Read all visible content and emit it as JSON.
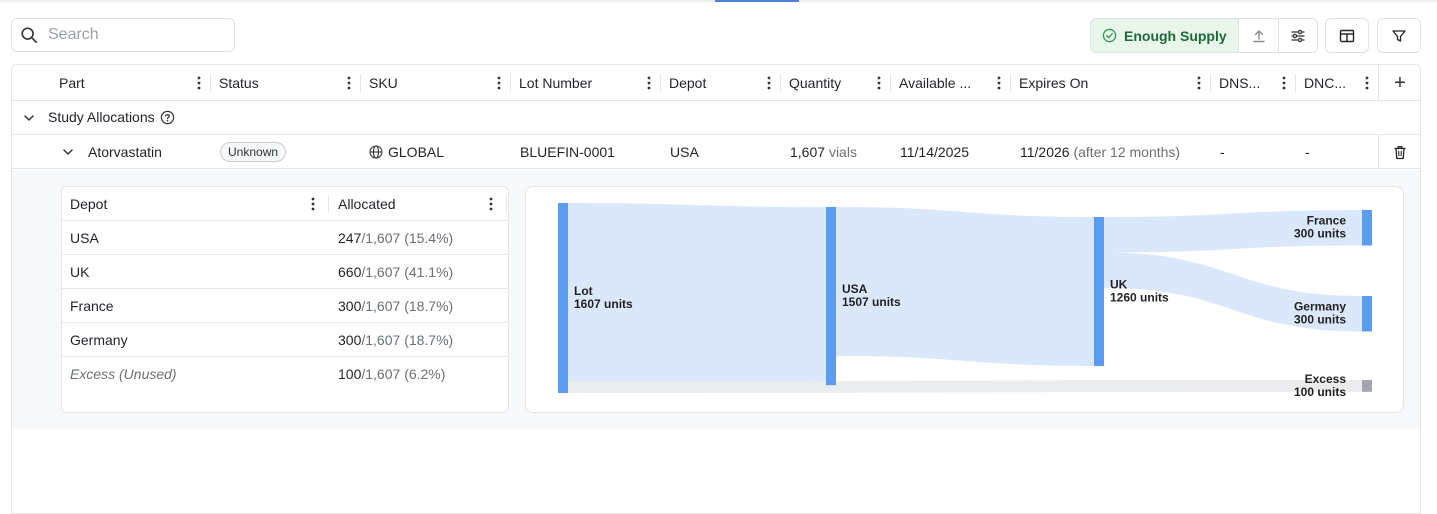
{
  "toolbar": {
    "search_placeholder": "Search",
    "supply_status": "Enough Supply",
    "supply_color": "#1e6b3a"
  },
  "columns": [
    {
      "label": "Part"
    },
    {
      "label": "Status"
    },
    {
      "label": "SKU"
    },
    {
      "label": "Lot Number"
    },
    {
      "label": "Depot"
    },
    {
      "label": "Quantity"
    },
    {
      "label": "Available ..."
    },
    {
      "label": "Expires On"
    },
    {
      "label": "DNS..."
    },
    {
      "label": "DNC..."
    }
  ],
  "group": {
    "title": "Study Allocations"
  },
  "row": {
    "part": "Atorvastatin",
    "status": "Unknown",
    "sku": "GLOBAL",
    "lot_number": "BLUEFIN-0001",
    "depot": "USA",
    "quantity": "1,607",
    "quantity_unit": "vials",
    "available": "11/14/2025",
    "expires": "11/2026",
    "expires_note": "(after 12 months)",
    "dns": "-",
    "dnc": "-"
  },
  "allocations": {
    "headers": {
      "depot": "Depot",
      "allocated": "Allocated"
    },
    "rows": [
      {
        "depot": "USA",
        "allocated": "247",
        "total": "/1,607",
        "pct": "(15.4%)",
        "italic": false
      },
      {
        "depot": "UK",
        "allocated": "660",
        "total": "/1,607",
        "pct": "(41.1%)",
        "italic": false
      },
      {
        "depot": "France",
        "allocated": "300",
        "total": "/1,607",
        "pct": "(18.7%)",
        "italic": false
      },
      {
        "depot": "Germany",
        "allocated": "300",
        "total": "/1,607",
        "pct": "(18.7%)",
        "italic": false
      },
      {
        "depot": "Excess (Unused)",
        "allocated": "100",
        "total": "/1,607",
        "pct": "(6.2%)",
        "italic": true
      }
    ]
  },
  "sankey": {
    "node_color": "#5b9cf0",
    "link_color": "#dbe8fb",
    "excess_color": "#a3a7ad",
    "excess_link_color": "#ebecee",
    "nodes": [
      {
        "id": "lot",
        "name": "Lot",
        "value": 1607,
        "label": "1607 units"
      },
      {
        "id": "usa",
        "name": "USA",
        "value": 1507,
        "label": "1507 units"
      },
      {
        "id": "uk",
        "name": "UK",
        "value": 1260,
        "label": "1260 units"
      },
      {
        "id": "france",
        "name": "France",
        "value": 300,
        "label": "300 units"
      },
      {
        "id": "germany",
        "name": "Germany",
        "value": 300,
        "label": "300 units"
      },
      {
        "id": "excess",
        "name": "Excess",
        "value": 100,
        "label": "100 units"
      }
    ],
    "links": [
      {
        "source": "lot",
        "target": "usa",
        "value": 1507
      },
      {
        "source": "lot",
        "target": "excess",
        "value": 100
      },
      {
        "source": "usa",
        "target": "uk",
        "value": 1260
      },
      {
        "source": "uk",
        "target": "france",
        "value": 300
      },
      {
        "source": "uk",
        "target": "germany",
        "value": 300
      }
    ]
  }
}
